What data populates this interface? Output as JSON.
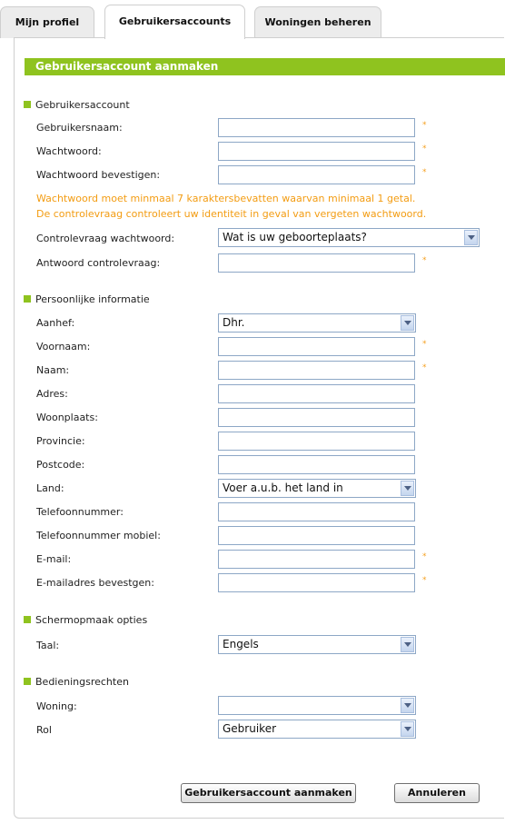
{
  "tabs": [
    {
      "label": "Mijn profiel"
    },
    {
      "label": "Gebruikersaccounts"
    },
    {
      "label": "Woningen beheren"
    }
  ],
  "panel_title": "Gebruikersaccount aanmaken",
  "required_marker": "*",
  "sections": {
    "account": "Gebruikersaccount",
    "personal": "Persoonlijke informatie",
    "display": "Schermopmaak opties",
    "rights": "Bedieningsrechten"
  },
  "account": {
    "username_label": "Gebruikersnaam:",
    "password_label": "Wachtwoord:",
    "password_confirm_label": "Wachtwoord bevestigen:",
    "note_line1": "Wachtwoord moet minmaal 7 karaktersbevatten waarvan minimaal 1 getal.",
    "note_line2": "De controlevraag controleert uw identiteit in geval van vergeten wachtwoord.",
    "security_question_label": "Controlevraag wachtwoord:",
    "security_question_value": "Wat is uw geboorteplaats?",
    "security_answer_label": "Antwoord controlevraag:"
  },
  "personal": {
    "salutation_label": "Aanhef:",
    "salutation_value": "Dhr.",
    "firstname_label": "Voornaam:",
    "lastname_label": "Naam:",
    "address_label": "Adres:",
    "city_label": "Woonplaats:",
    "province_label": "Provincie:",
    "postcode_label": "Postcode:",
    "country_label": "Land:",
    "country_value": "Voer a.u.b. het land in",
    "phone_label": "Telefoonnummer:",
    "mobile_label": "Telefoonnummer mobiel:",
    "email_label": "E-mail:",
    "email_confirm_label": "E-mailadres bevestgen:"
  },
  "display": {
    "language_label": "Taal:",
    "language_value": "Engels"
  },
  "rights": {
    "home_label": "Woning:",
    "home_value": "",
    "role_label": "Rol",
    "role_value": "Gebruiker"
  },
  "buttons": {
    "create": "Gebruikersaccount aanmaken",
    "cancel": "Annuleren"
  }
}
